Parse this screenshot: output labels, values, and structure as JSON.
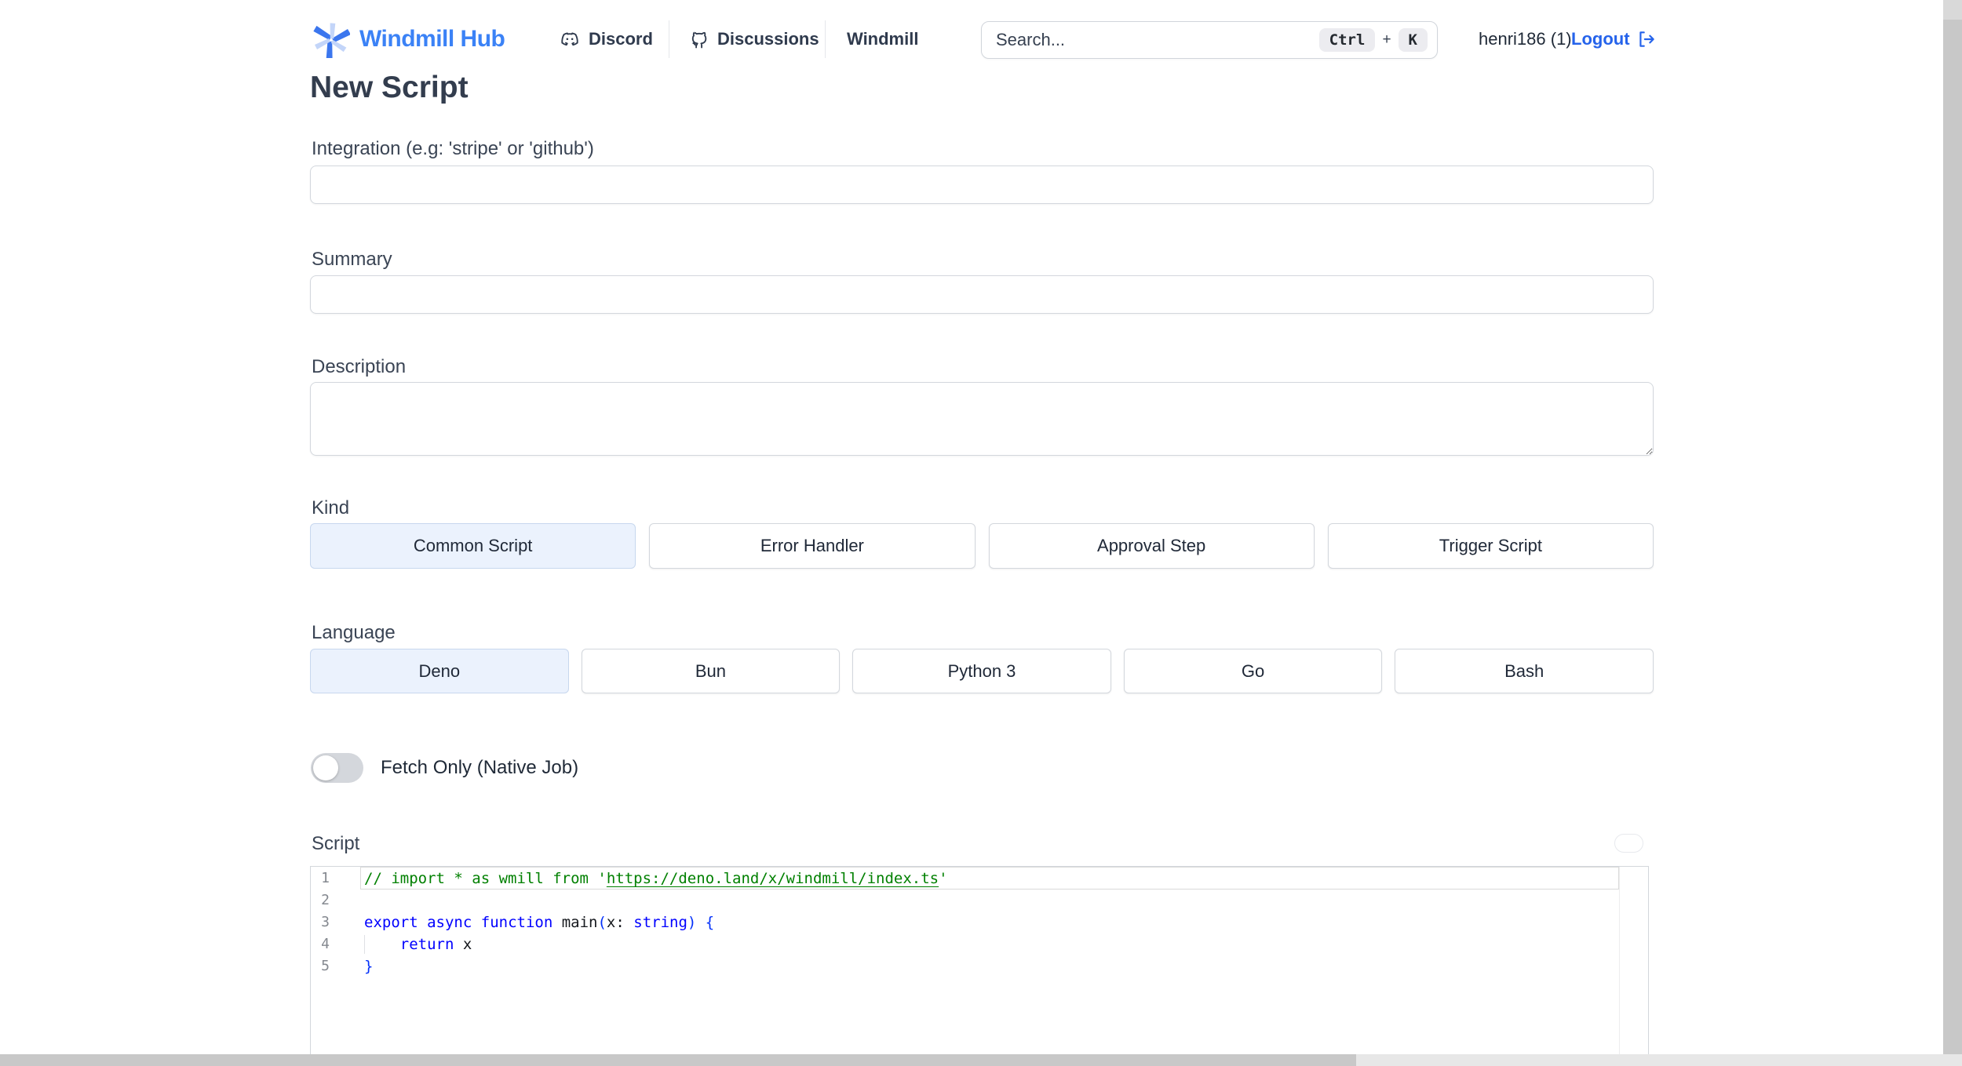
{
  "header": {
    "logo_text": "Windmill Hub",
    "nav": [
      {
        "label": "Discord",
        "icon": "discord-icon"
      },
      {
        "label": "Discussions",
        "icon": "github-icon"
      },
      {
        "label": "Windmill",
        "icon": null
      }
    ],
    "search": {
      "placeholder": "Search...",
      "shortcut_key_1": "Ctrl",
      "shortcut_plus": "+",
      "shortcut_key_2": "K"
    },
    "user_name": "henri186 (1)",
    "logout_label": "Logout"
  },
  "page": {
    "title": "New Script"
  },
  "form": {
    "integration_label": "Integration (e.g: 'stripe' or 'github')",
    "integration_value": "",
    "summary_label": "Summary",
    "summary_value": "",
    "description_label": "Description",
    "description_value": "",
    "kind_label": "Kind",
    "kinds": [
      {
        "label": "Common Script",
        "selected": true
      },
      {
        "label": "Error Handler",
        "selected": false
      },
      {
        "label": "Approval Step",
        "selected": false
      },
      {
        "label": "Trigger Script",
        "selected": false
      }
    ],
    "language_label": "Language",
    "languages": [
      {
        "label": "Deno",
        "selected": true
      },
      {
        "label": "Bun",
        "selected": false
      },
      {
        "label": "Python 3",
        "selected": false
      },
      {
        "label": "Go",
        "selected": false
      },
      {
        "label": "Bash",
        "selected": false
      }
    ],
    "fetch_only_label": "Fetch Only (Native Job)",
    "fetch_only_on": false,
    "script_label": "Script"
  },
  "editor": {
    "lines": [
      {
        "num": "1",
        "current": true,
        "tokens": [
          {
            "text": "// import * as wmill from '",
            "type": "comment"
          },
          {
            "text": "https://deno.land/x/windmill/index.ts",
            "type": "comment-link"
          },
          {
            "text": "'",
            "type": "comment"
          }
        ]
      },
      {
        "num": "2",
        "tokens": []
      },
      {
        "num": "3",
        "tokens": [
          {
            "text": "export",
            "type": "keyword"
          },
          {
            "text": " ",
            "type": "plain"
          },
          {
            "text": "async",
            "type": "keyword"
          },
          {
            "text": " ",
            "type": "plain"
          },
          {
            "text": "function",
            "type": "keyword"
          },
          {
            "text": " main",
            "type": "plain"
          },
          {
            "text": "(",
            "type": "bracket"
          },
          {
            "text": "x: ",
            "type": "plain"
          },
          {
            "text": "string",
            "type": "keyword"
          },
          {
            "text": ")",
            "type": "bracket"
          },
          {
            "text": " ",
            "type": "plain"
          },
          {
            "text": "{",
            "type": "bracket"
          }
        ]
      },
      {
        "num": "4",
        "indent_guide": true,
        "tokens": [
          {
            "text": "    ",
            "type": "plain"
          },
          {
            "text": "return",
            "type": "keyword"
          },
          {
            "text": " x",
            "type": "plain"
          }
        ]
      },
      {
        "num": "5",
        "tokens": [
          {
            "text": "}",
            "type": "bracket"
          }
        ]
      }
    ]
  },
  "colors": {
    "accent": "#3b82f6",
    "link": "#2563eb",
    "selected_bg": "#ebf2fd",
    "selected_border": "#c7d7ee",
    "code_comment": "#008000",
    "code_keyword": "#0000ff",
    "code_bracket": "#0431fa"
  }
}
